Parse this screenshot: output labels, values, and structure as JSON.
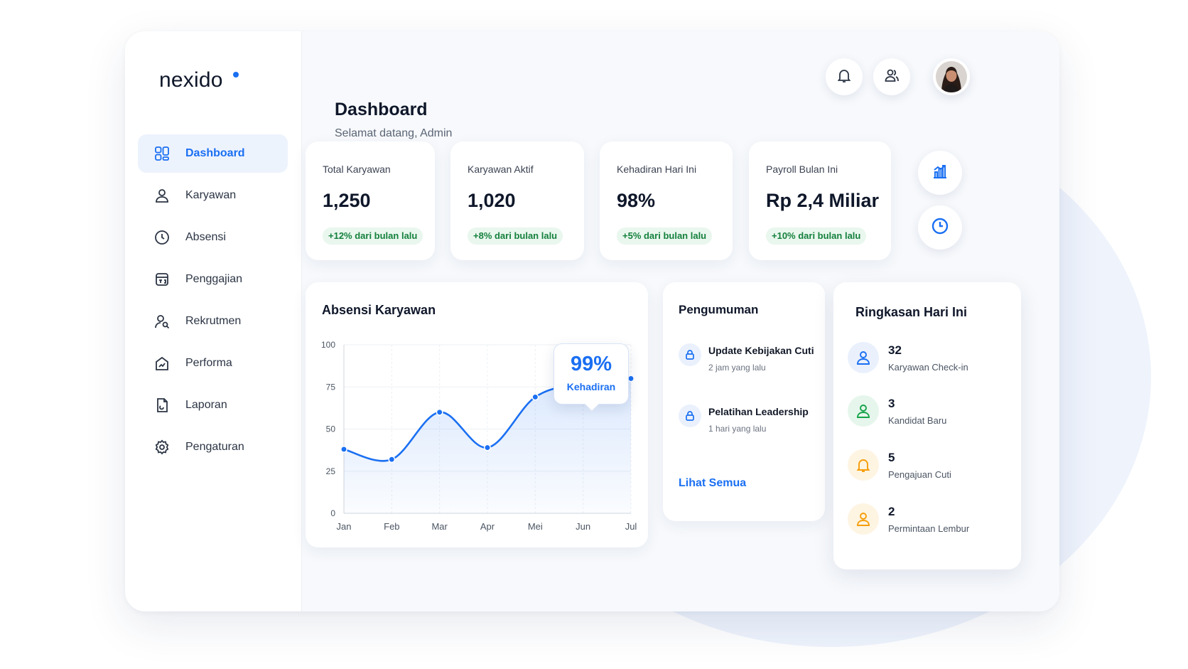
{
  "app": {
    "logo": "nexido",
    "brand_color": "#1a6ff2"
  },
  "sidebar": {
    "items": [
      {
        "label": "Dashboard",
        "icon": "grid-icon",
        "active": true
      },
      {
        "label": "Karyawan",
        "icon": "user-icon"
      },
      {
        "label": "Absensi",
        "icon": "clock-icon"
      },
      {
        "label": "Penggajian",
        "icon": "payroll-icon"
      },
      {
        "label": "Rekrutmen",
        "icon": "user-search-icon"
      },
      {
        "label": "Performa",
        "icon": "performance-icon"
      },
      {
        "label": "Laporan",
        "icon": "report-icon"
      },
      {
        "label": "Pengaturan",
        "icon": "gear-icon"
      }
    ]
  },
  "header": {
    "title": "Dashboard",
    "subtitle": "Selamat datang, Admin",
    "icons": [
      "bell-icon",
      "users-icon",
      "avatar"
    ]
  },
  "stats": [
    {
      "label": "Total Karyawan",
      "value": "1,250",
      "change": "+12% dari bulan lalu"
    },
    {
      "label": "Karyawan Aktif",
      "value": "1,020",
      "change": "+8% dari bulan lalu"
    },
    {
      "label": "Kehadiran Hari Ini",
      "value": "98%",
      "change": "+5% dari bulan lalu"
    },
    {
      "label": "Payroll Bulan Ini",
      "value": "Rp 2,4 Miliar",
      "change": "+10% dari bulan lalu"
    }
  ],
  "quick_actions": [
    "chart-icon",
    "clock-icon"
  ],
  "attendance_card": {
    "title": "Absensi Karyawan",
    "tooltip": {
      "value": "99%",
      "label": "Kehadiran"
    }
  },
  "chart_data": {
    "type": "line",
    "categories": [
      "Jan",
      "Feb",
      "Mar",
      "Apr",
      "Mei",
      "Jun",
      "Jul"
    ],
    "values": [
      38,
      32,
      60,
      39,
      69,
      77,
      80
    ],
    "ylim": [
      0,
      100
    ],
    "yticks": [
      "0",
      "25",
      "50",
      "75",
      "100"
    ],
    "grid": true,
    "color": "#1a6ff2"
  },
  "announcements": {
    "title": "Pengumuman",
    "items": [
      {
        "title": "Update Kebijakan Cuti",
        "time": "2 jam yang lalu"
      },
      {
        "title": "Pelatihan Leadership",
        "time": "1 hari yang lalu"
      }
    ],
    "see_all": "Lihat Semua"
  },
  "summary": {
    "title": "Ringkasan Hari Ini",
    "items": [
      {
        "value": "32",
        "label": "Karyawan Check-in",
        "color": "#1a6ff2",
        "bg": "#eaf1fd"
      },
      {
        "value": "3",
        "label": "Kandidat Baru",
        "color": "#16a34a",
        "bg": "#e6f6ec"
      },
      {
        "value": "5",
        "label": "Pengajuan Cuti",
        "color": "#f59e0b",
        "bg": "#fef4e2"
      },
      {
        "value": "2",
        "label": "Permintaan Lembur",
        "color": "#f59e0b",
        "bg": "#fef4e2"
      }
    ]
  }
}
